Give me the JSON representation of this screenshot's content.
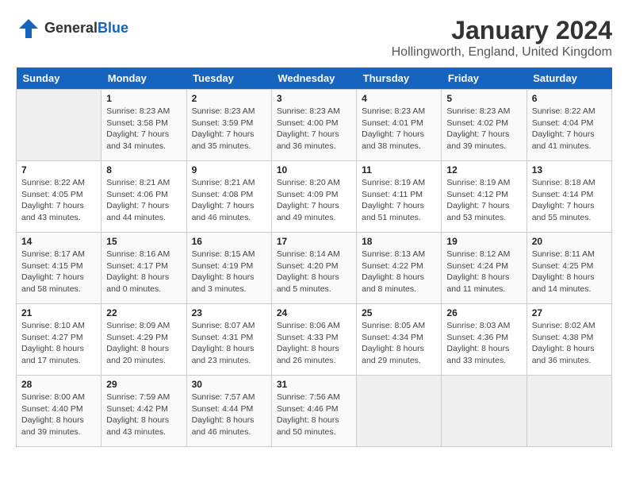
{
  "header": {
    "logo_general": "General",
    "logo_blue": "Blue",
    "month_title": "January 2024",
    "location": "Hollingworth, England, United Kingdom"
  },
  "days_of_week": [
    "Sunday",
    "Monday",
    "Tuesday",
    "Wednesday",
    "Thursday",
    "Friday",
    "Saturday"
  ],
  "weeks": [
    [
      {
        "day": "",
        "sunrise": "",
        "sunset": "",
        "daylight": ""
      },
      {
        "day": "1",
        "sunrise": "Sunrise: 8:23 AM",
        "sunset": "Sunset: 3:58 PM",
        "daylight": "Daylight: 7 hours and 34 minutes."
      },
      {
        "day": "2",
        "sunrise": "Sunrise: 8:23 AM",
        "sunset": "Sunset: 3:59 PM",
        "daylight": "Daylight: 7 hours and 35 minutes."
      },
      {
        "day": "3",
        "sunrise": "Sunrise: 8:23 AM",
        "sunset": "Sunset: 4:00 PM",
        "daylight": "Daylight: 7 hours and 36 minutes."
      },
      {
        "day": "4",
        "sunrise": "Sunrise: 8:23 AM",
        "sunset": "Sunset: 4:01 PM",
        "daylight": "Daylight: 7 hours and 38 minutes."
      },
      {
        "day": "5",
        "sunrise": "Sunrise: 8:23 AM",
        "sunset": "Sunset: 4:02 PM",
        "daylight": "Daylight: 7 hours and 39 minutes."
      },
      {
        "day": "6",
        "sunrise": "Sunrise: 8:22 AM",
        "sunset": "Sunset: 4:04 PM",
        "daylight": "Daylight: 7 hours and 41 minutes."
      }
    ],
    [
      {
        "day": "7",
        "sunrise": "Sunrise: 8:22 AM",
        "sunset": "Sunset: 4:05 PM",
        "daylight": "Daylight: 7 hours and 43 minutes."
      },
      {
        "day": "8",
        "sunrise": "Sunrise: 8:21 AM",
        "sunset": "Sunset: 4:06 PM",
        "daylight": "Daylight: 7 hours and 44 minutes."
      },
      {
        "day": "9",
        "sunrise": "Sunrise: 8:21 AM",
        "sunset": "Sunset: 4:08 PM",
        "daylight": "Daylight: 7 hours and 46 minutes."
      },
      {
        "day": "10",
        "sunrise": "Sunrise: 8:20 AM",
        "sunset": "Sunset: 4:09 PM",
        "daylight": "Daylight: 7 hours and 49 minutes."
      },
      {
        "day": "11",
        "sunrise": "Sunrise: 8:19 AM",
        "sunset": "Sunset: 4:11 PM",
        "daylight": "Daylight: 7 hours and 51 minutes."
      },
      {
        "day": "12",
        "sunrise": "Sunrise: 8:19 AM",
        "sunset": "Sunset: 4:12 PM",
        "daylight": "Daylight: 7 hours and 53 minutes."
      },
      {
        "day": "13",
        "sunrise": "Sunrise: 8:18 AM",
        "sunset": "Sunset: 4:14 PM",
        "daylight": "Daylight: 7 hours and 55 minutes."
      }
    ],
    [
      {
        "day": "14",
        "sunrise": "Sunrise: 8:17 AM",
        "sunset": "Sunset: 4:15 PM",
        "daylight": "Daylight: 7 hours and 58 minutes."
      },
      {
        "day": "15",
        "sunrise": "Sunrise: 8:16 AM",
        "sunset": "Sunset: 4:17 PM",
        "daylight": "Daylight: 8 hours and 0 minutes."
      },
      {
        "day": "16",
        "sunrise": "Sunrise: 8:15 AM",
        "sunset": "Sunset: 4:19 PM",
        "daylight": "Daylight: 8 hours and 3 minutes."
      },
      {
        "day": "17",
        "sunrise": "Sunrise: 8:14 AM",
        "sunset": "Sunset: 4:20 PM",
        "daylight": "Daylight: 8 hours and 5 minutes."
      },
      {
        "day": "18",
        "sunrise": "Sunrise: 8:13 AM",
        "sunset": "Sunset: 4:22 PM",
        "daylight": "Daylight: 8 hours and 8 minutes."
      },
      {
        "day": "19",
        "sunrise": "Sunrise: 8:12 AM",
        "sunset": "Sunset: 4:24 PM",
        "daylight": "Daylight: 8 hours and 11 minutes."
      },
      {
        "day": "20",
        "sunrise": "Sunrise: 8:11 AM",
        "sunset": "Sunset: 4:25 PM",
        "daylight": "Daylight: 8 hours and 14 minutes."
      }
    ],
    [
      {
        "day": "21",
        "sunrise": "Sunrise: 8:10 AM",
        "sunset": "Sunset: 4:27 PM",
        "daylight": "Daylight: 8 hours and 17 minutes."
      },
      {
        "day": "22",
        "sunrise": "Sunrise: 8:09 AM",
        "sunset": "Sunset: 4:29 PM",
        "daylight": "Daylight: 8 hours and 20 minutes."
      },
      {
        "day": "23",
        "sunrise": "Sunrise: 8:07 AM",
        "sunset": "Sunset: 4:31 PM",
        "daylight": "Daylight: 8 hours and 23 minutes."
      },
      {
        "day": "24",
        "sunrise": "Sunrise: 8:06 AM",
        "sunset": "Sunset: 4:33 PM",
        "daylight": "Daylight: 8 hours and 26 minutes."
      },
      {
        "day": "25",
        "sunrise": "Sunrise: 8:05 AM",
        "sunset": "Sunset: 4:34 PM",
        "daylight": "Daylight: 8 hours and 29 minutes."
      },
      {
        "day": "26",
        "sunrise": "Sunrise: 8:03 AM",
        "sunset": "Sunset: 4:36 PM",
        "daylight": "Daylight: 8 hours and 33 minutes."
      },
      {
        "day": "27",
        "sunrise": "Sunrise: 8:02 AM",
        "sunset": "Sunset: 4:38 PM",
        "daylight": "Daylight: 8 hours and 36 minutes."
      }
    ],
    [
      {
        "day": "28",
        "sunrise": "Sunrise: 8:00 AM",
        "sunset": "Sunset: 4:40 PM",
        "daylight": "Daylight: 8 hours and 39 minutes."
      },
      {
        "day": "29",
        "sunrise": "Sunrise: 7:59 AM",
        "sunset": "Sunset: 4:42 PM",
        "daylight": "Daylight: 8 hours and 43 minutes."
      },
      {
        "day": "30",
        "sunrise": "Sunrise: 7:57 AM",
        "sunset": "Sunset: 4:44 PM",
        "daylight": "Daylight: 8 hours and 46 minutes."
      },
      {
        "day": "31",
        "sunrise": "Sunrise: 7:56 AM",
        "sunset": "Sunset: 4:46 PM",
        "daylight": "Daylight: 8 hours and 50 minutes."
      },
      {
        "day": "",
        "sunrise": "",
        "sunset": "",
        "daylight": ""
      },
      {
        "day": "",
        "sunrise": "",
        "sunset": "",
        "daylight": ""
      },
      {
        "day": "",
        "sunrise": "",
        "sunset": "",
        "daylight": ""
      }
    ]
  ]
}
